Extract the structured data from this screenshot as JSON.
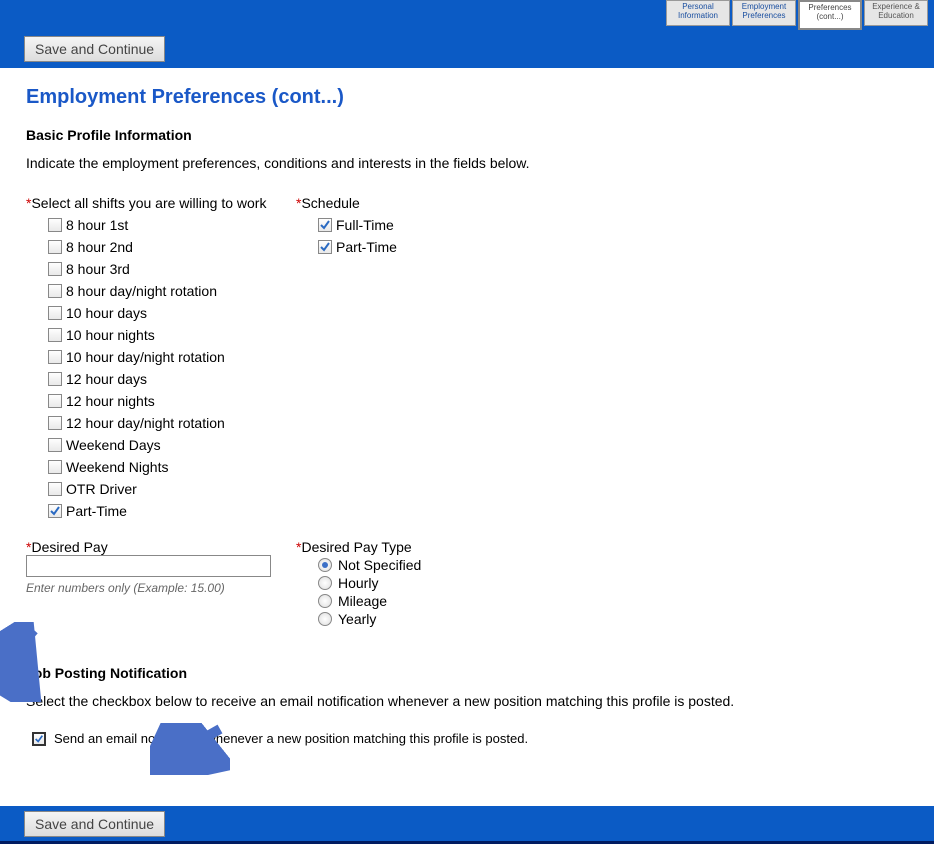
{
  "nav": {
    "steps": [
      {
        "label": "Personal Information"
      },
      {
        "label": "Employment Preferences"
      },
      {
        "label": "Preferences (cont...)",
        "active": true
      },
      {
        "label": "Experience & Education"
      }
    ]
  },
  "buttons": {
    "save_continue": "Save and Continue"
  },
  "page": {
    "title": "Employment Preferences (cont...)",
    "basic_h": "Basic Profile Information",
    "basic_instr": "Indicate the employment preferences, conditions and interests in the fields below."
  },
  "shifts": {
    "label": "Select all shifts you are willing to work",
    "items": [
      {
        "label": "8 hour 1st",
        "checked": false
      },
      {
        "label": "8 hour 2nd",
        "checked": false
      },
      {
        "label": "8 hour 3rd",
        "checked": false
      },
      {
        "label": "8 hour day/night rotation",
        "checked": false
      },
      {
        "label": "10 hour days",
        "checked": false
      },
      {
        "label": "10 hour nights",
        "checked": false
      },
      {
        "label": "10 hour day/night rotation",
        "checked": false
      },
      {
        "label": "12 hour days",
        "checked": false
      },
      {
        "label": "12 hour nights",
        "checked": false
      },
      {
        "label": "12 hour day/night rotation",
        "checked": false
      },
      {
        "label": "Weekend Days",
        "checked": false
      },
      {
        "label": "Weekend Nights",
        "checked": false
      },
      {
        "label": "OTR Driver",
        "checked": false
      },
      {
        "label": "Part-Time",
        "checked": true
      }
    ]
  },
  "schedule": {
    "label": "Schedule",
    "items": [
      {
        "label": "Full-Time",
        "checked": true
      },
      {
        "label": "Part-Time",
        "checked": true
      }
    ]
  },
  "pay": {
    "label": "Desired Pay",
    "value": "",
    "hint": "Enter numbers only (Example: 15.00)"
  },
  "pay_type": {
    "label": "Desired Pay Type",
    "options": [
      {
        "label": "Not Specified",
        "checked": true
      },
      {
        "label": "Hourly",
        "checked": false
      },
      {
        "label": "Mileage",
        "checked": false
      },
      {
        "label": "Yearly",
        "checked": false
      }
    ]
  },
  "notif": {
    "h": "Job Posting Notification",
    "instr": "Select the checkbox below to receive an email notification whenever a new position matching this profile is posted.",
    "cb_label": "Send an email notification whenever a new position matching this profile is posted.",
    "checked": true
  }
}
